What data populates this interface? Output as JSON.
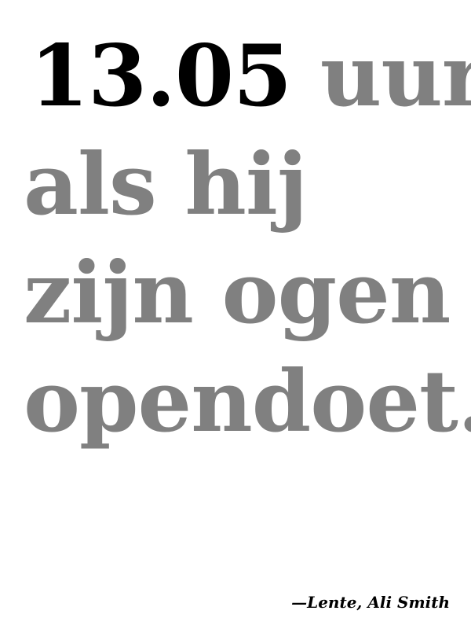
{
  "quote": {
    "time": "13.05",
    "line1_rest": "uur",
    "line2": "als hij",
    "line3": "zijn ogen",
    "line4": "opendoet."
  },
  "attribution": "—Lente, Ali Smith",
  "colors": {
    "background": "#ffffff",
    "time_text": "#000000",
    "quote_text": "#808080",
    "attribution_text": "#000000"
  }
}
